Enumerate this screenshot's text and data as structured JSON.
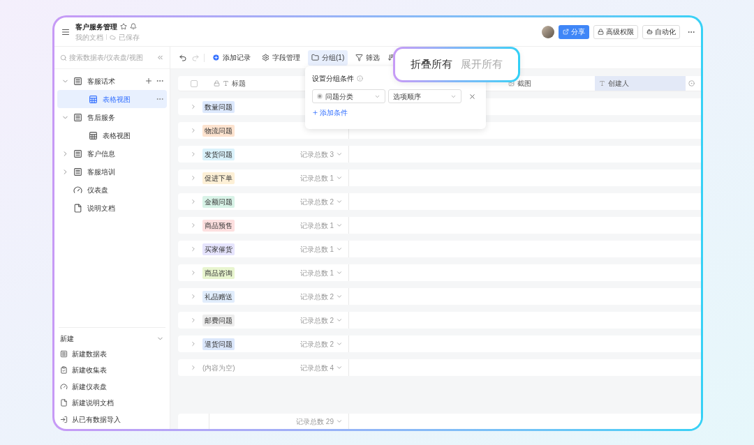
{
  "doc": {
    "title": "客户服务管理",
    "breadcrumb": "我的文档",
    "save_status": "已保存"
  },
  "header_actions": [
    {
      "label": "分享",
      "kind": "primary"
    },
    {
      "label": "高级权限",
      "kind": "lock"
    },
    {
      "label": "自动化",
      "kind": "auto"
    }
  ],
  "sidebar": {
    "search": {
      "placeholder": "搜索数据表/仪表盘/视图"
    },
    "items": [
      {
        "label": "客服话术",
        "kind": "table",
        "expanded": true,
        "selected": false,
        "children": [
          {
            "label": "表格视图",
            "kind": "view",
            "selected": true
          }
        ]
      },
      {
        "label": "售后服务",
        "kind": "table",
        "expanded": true,
        "selected": false,
        "children": [
          {
            "label": "表格视图",
            "kind": "view",
            "selected": false
          }
        ]
      },
      {
        "label": "客户信息",
        "kind": "table",
        "expanded": false,
        "selected": false
      },
      {
        "label": "客服培训",
        "kind": "table",
        "expanded": false,
        "selected": false
      },
      {
        "label": "仪表盘",
        "kind": "dashboard",
        "selected": false
      },
      {
        "label": "说明文档",
        "kind": "doc",
        "selected": false
      }
    ],
    "new_section": {
      "title": "新建",
      "expanded": true,
      "items": [
        {
          "label": "新建数据表",
          "kind": "table"
        },
        {
          "label": "新建收集表",
          "kind": "form"
        },
        {
          "label": "新建仪表盘",
          "kind": "dashboard"
        },
        {
          "label": "新建说明文档",
          "kind": "doc"
        },
        {
          "label": "从已有数据导入",
          "kind": "import"
        }
      ]
    }
  },
  "toolbar": [
    {
      "label": "添加记录",
      "kind": "add",
      "selected": false
    },
    {
      "label": "字段管理",
      "kind": "fields",
      "selected": false
    },
    {
      "label": "分组(1)",
      "kind": "group",
      "selected": true
    },
    {
      "label": "筛选",
      "kind": "filter",
      "selected": false
    }
  ],
  "table": {
    "select_all": {
      "checked": false
    },
    "columns": [
      {
        "label": "标题",
        "kind": "title",
        "selected": false
      },
      {
        "label": "截图",
        "kind": "image",
        "selected": false
      },
      {
        "label": "创建人",
        "kind": "text",
        "selected": true
      }
    ],
    "groups": [
      {
        "tag": "数量问题",
        "color": "#dde9fd"
      },
      {
        "tag": "物流问题",
        "color": "#fde3cf"
      },
      {
        "tag": "发货问题",
        "color": "#daf2fb",
        "count": "记录总数 3"
      },
      {
        "tag": "促进下单",
        "color": "#fdf0d6",
        "count": "记录总数 1"
      },
      {
        "tag": "金额问题",
        "color": "#d8f3e7",
        "count": "记录总数 2"
      },
      {
        "tag": "商品预售",
        "color": "#fde0e0",
        "count": "记录总数 1"
      },
      {
        "tag": "买家催货",
        "color": "#e6e4fd",
        "count": "记录总数 1"
      },
      {
        "tag": "商品咨询",
        "color": "#e8f5cf",
        "count": "记录总数 1"
      },
      {
        "tag": "礼品赠送",
        "color": "#e1edfc",
        "count": "记录总数 2"
      },
      {
        "tag": "邮费问题",
        "color": "#ededed",
        "count": "记录总数 2"
      },
      {
        "tag": "退货问题",
        "color": "#dbe7fb",
        "count": "记录总数 2"
      },
      {
        "empty_label": "(内容为空)",
        "count": "记录总数 4"
      }
    ],
    "total": "记录总数 29"
  },
  "group_popup": {
    "title": "设置分组条件",
    "field": "问题分类",
    "order": "选项顺序",
    "add": "添加条件"
  },
  "callout": [
    {
      "label": "折叠所有",
      "selected": true
    },
    {
      "label": "展开所有",
      "selected": false
    }
  ]
}
